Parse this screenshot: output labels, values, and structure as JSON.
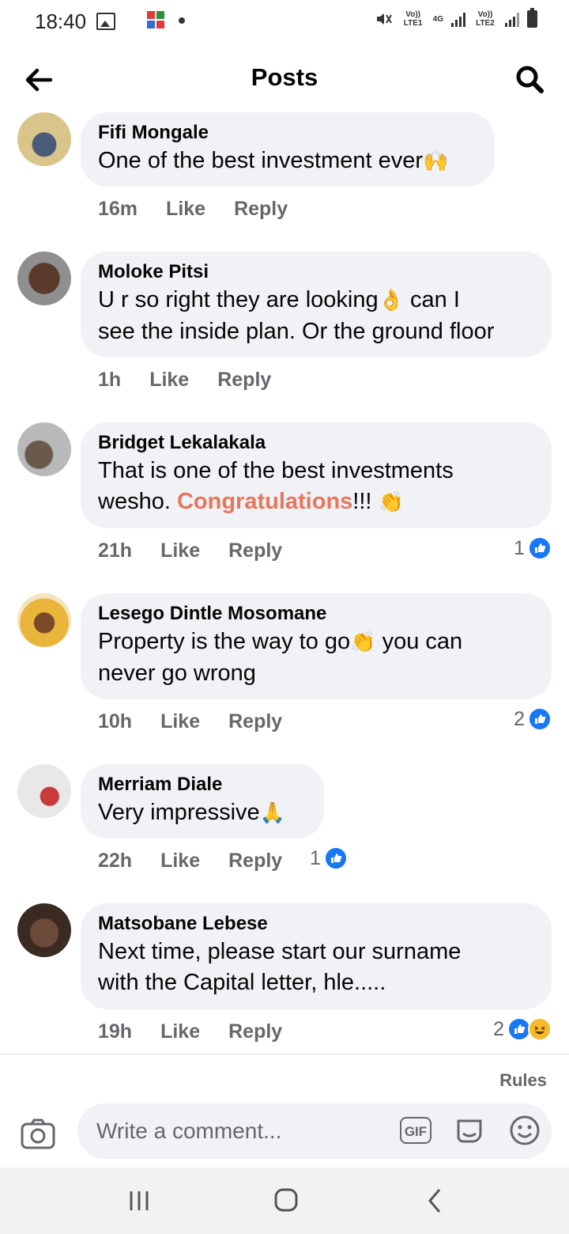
{
  "status_bar": {
    "time": "18:40",
    "sim1_label": "Vo)) LTE1",
    "network": "4G",
    "sim2_label": "Vo)) LTE2"
  },
  "header": {
    "title": "Posts",
    "back_icon": "arrow-left-icon",
    "search_icon": "search-icon"
  },
  "comments": [
    {
      "author": "Fifi Mongale",
      "text": "One of the best investment ever",
      "emoji": "🙌",
      "time": "16m",
      "like_label": "Like",
      "reply_label": "Reply",
      "reaction_count": ""
    },
    {
      "author": "Moloke Pitsi",
      "text_line1": "U r so right  they are looking",
      "emoji": "👌",
      "text_line1_after": " can I",
      "text_line2": "see the inside plan. Or the ground floor",
      "time": "1h",
      "like_label": "Like",
      "reply_label": "Reply",
      "reaction_count": ""
    },
    {
      "author": "Bridget Lekalakala",
      "text_line1": "That is one of the best investments",
      "text_line2_before": "wesho. ",
      "text_highlight": "Congratulations",
      "text_line2_after": "!!! ",
      "emoji": "👏",
      "time": "21h",
      "like_label": "Like",
      "reply_label": "Reply",
      "reaction_count": "1"
    },
    {
      "author": "Lesego Dintle Mosomane",
      "text_line1_before": "Property is the way to go",
      "emoji": "👏",
      "text_line1_after": " you can",
      "text_line2": "never go wrong",
      "time": "10h",
      "like_label": "Like",
      "reply_label": "Reply",
      "reaction_count": "2"
    },
    {
      "author": "Merriam Diale",
      "text": "Very impressive",
      "emoji": "🙏",
      "time": "22h",
      "like_label": "Like",
      "reply_label": "Reply",
      "reaction_count": "1"
    },
    {
      "author": "Matsobane Lebese",
      "text_line1": "Next time, please start our surname",
      "text_line2": "with the Capital letter, hle.....",
      "time": "19h",
      "like_label": "Like",
      "reply_label": "Reply",
      "reaction_count": "2"
    }
  ],
  "composer": {
    "rules_label": "Rules",
    "placeholder": "Write a comment...",
    "gif_label": "GIF"
  },
  "colors": {
    "accent": "#1877f2",
    "highlight": "#e8765c",
    "bubble": "#f0f2f5",
    "muted": "#65676b"
  }
}
